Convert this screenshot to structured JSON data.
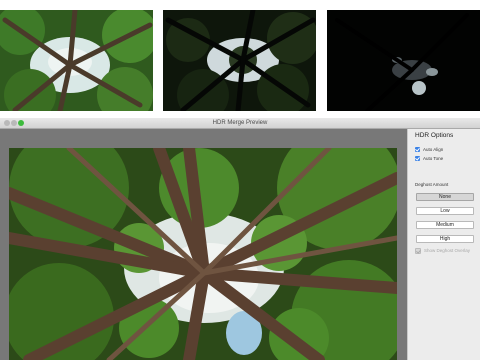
{
  "thumbnails": [
    {
      "name": "exposure-normal"
    },
    {
      "name": "exposure-under"
    },
    {
      "name": "exposure-very-under"
    }
  ],
  "window": {
    "title": "HDR Merge Preview"
  },
  "panel": {
    "title": "HDR Options",
    "auto_align": {
      "label": "Auto Align",
      "checked": true
    },
    "auto_tone": {
      "label": "Auto Tone",
      "checked": true
    },
    "deghost_label": "Deghost Amount",
    "deghost_options": [
      "None",
      "Low",
      "Medium",
      "High"
    ],
    "deghost_selected": "None",
    "show_overlay": {
      "label": "Show Deghost Overlay",
      "checked": false,
      "enabled": false
    }
  },
  "colors": {
    "accent": "#3b82e6",
    "traffic_green": "#3dbb3d",
    "preview_background": "#787878"
  }
}
